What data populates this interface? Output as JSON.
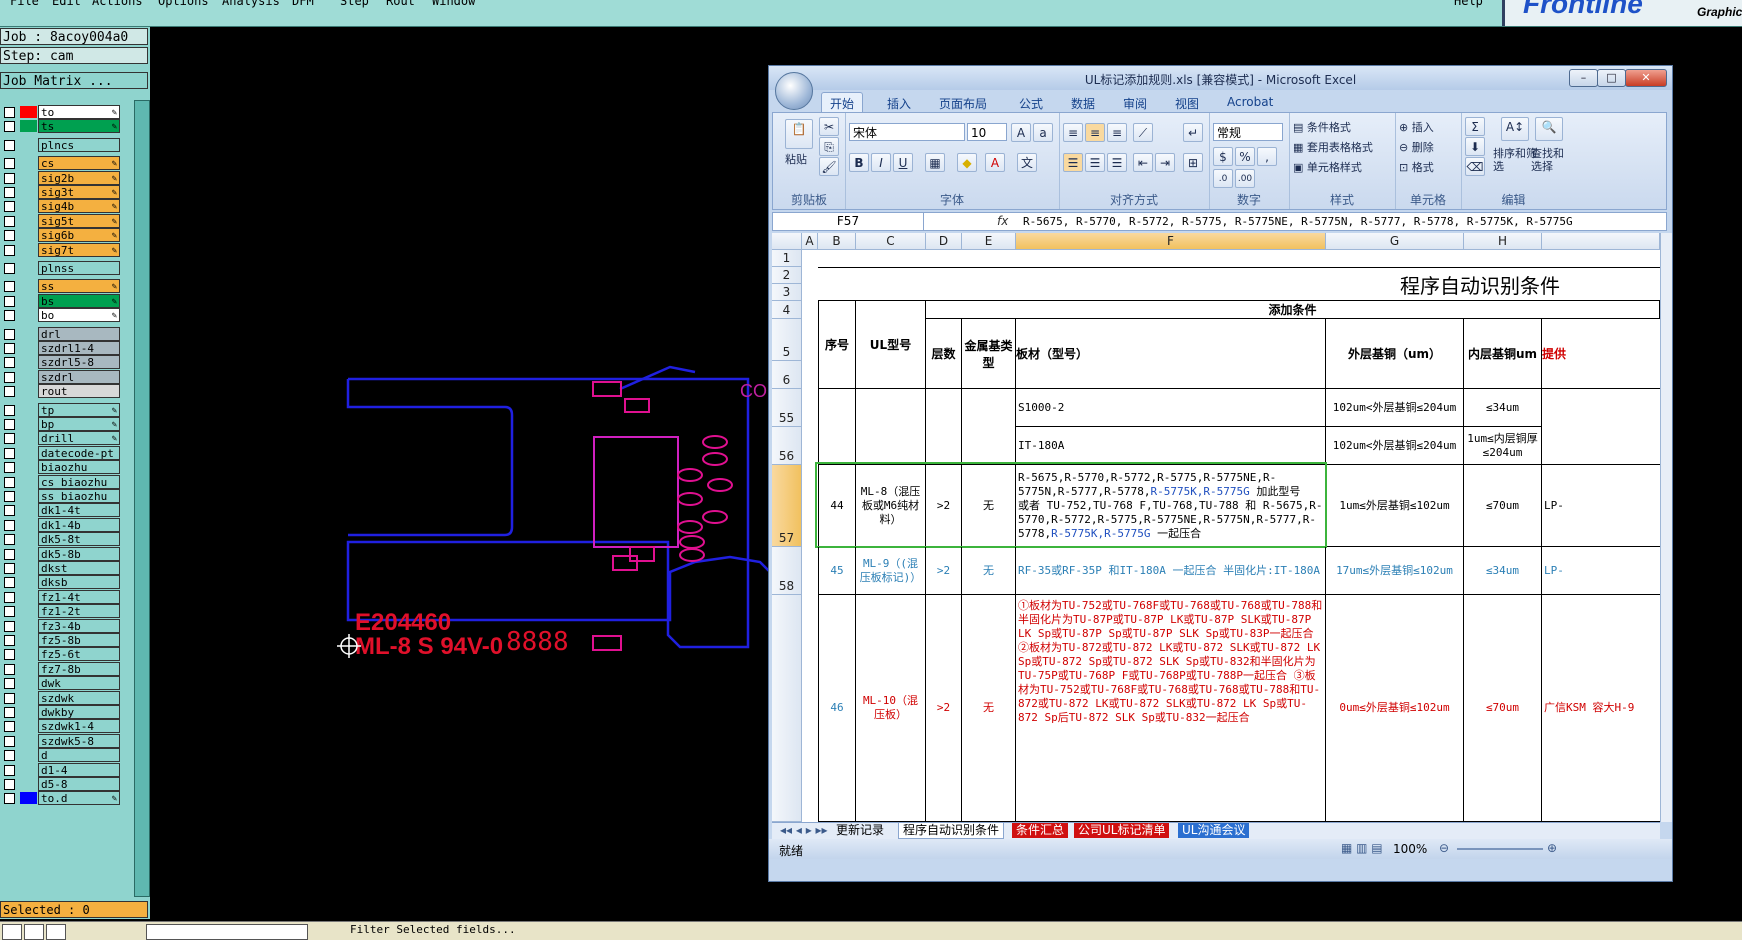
{
  "menubar": {
    "items": [
      "File",
      "Edit",
      "Actions",
      "Options",
      "Analysis",
      "DFM",
      "Step",
      "Rout",
      "Window"
    ],
    "help": "Help"
  },
  "logo": {
    "text": "Frontline",
    "sub": "Graphic"
  },
  "job": {
    "job_line": "Job : 8acoy004a0",
    "step_line": "Step: cam",
    "matrix_button": "Job Matrix ..."
  },
  "layers": [
    {
      "name": "to",
      "swatch": "#ff0000",
      "bg": "#ffffff",
      "pen": true
    },
    {
      "name": "ts",
      "swatch": "#00a050",
      "bg": "#00a050",
      "pen": true
    },
    {
      "name": "plncs",
      "swatch": "",
      "bg": "#8fd4ce",
      "pen": false
    },
    {
      "name": "cs",
      "swatch": "",
      "bg": "#f4b040",
      "pen": true
    },
    {
      "name": "sig2b",
      "swatch": "",
      "bg": "#f4b040",
      "pen": true
    },
    {
      "name": "sig3t",
      "swatch": "",
      "bg": "#f4b040",
      "pen": true
    },
    {
      "name": "sig4b",
      "swatch": "",
      "bg": "#f4b040",
      "pen": true
    },
    {
      "name": "sig5t",
      "swatch": "",
      "bg": "#f4b040",
      "pen": true
    },
    {
      "name": "sig6b",
      "swatch": "",
      "bg": "#f4b040",
      "pen": true
    },
    {
      "name": "sig7t",
      "swatch": "",
      "bg": "#f4b040",
      "pen": true
    },
    {
      "name": "plnss",
      "swatch": "",
      "bg": "#8fd4ce",
      "pen": false
    },
    {
      "name": "ss",
      "swatch": "",
      "bg": "#f4b040",
      "pen": true
    },
    {
      "name": "bs",
      "swatch": "",
      "bg": "#00a050",
      "pen": true
    },
    {
      "name": "bo",
      "swatch": "",
      "bg": "#ffffff",
      "pen": true
    },
    {
      "name": "drl",
      "swatch": "",
      "bg": "#a8b8c0",
      "pen": false
    },
    {
      "name": "szdrl1-4",
      "swatch": "",
      "bg": "#a8b8c0",
      "pen": false
    },
    {
      "name": "szdrl5-8",
      "swatch": "",
      "bg": "#a8b8c0",
      "pen": false
    },
    {
      "name": "szdrl",
      "swatch": "",
      "bg": "#a8b8c0",
      "pen": false
    },
    {
      "name": "rout",
      "swatch": "",
      "bg": "#d8d8d8",
      "pen": false
    },
    {
      "name": "tp",
      "swatch": "",
      "bg": "#8fd4ce",
      "pen": true
    },
    {
      "name": "bp",
      "swatch": "",
      "bg": "#8fd4ce",
      "pen": true
    },
    {
      "name": "drill",
      "swatch": "",
      "bg": "#8fd4ce",
      "pen": true
    },
    {
      "name": "datecode-pt",
      "swatch": "",
      "bg": "#8fd4ce",
      "pen": false
    },
    {
      "name": "biaozhu",
      "swatch": "",
      "bg": "#8fd4ce",
      "pen": false
    },
    {
      "name": "cs_biaozhu",
      "swatch": "",
      "bg": "#8fd4ce",
      "pen": false
    },
    {
      "name": "ss_biaozhu",
      "swatch": "",
      "bg": "#8fd4ce",
      "pen": false
    },
    {
      "name": "dk1-4t",
      "swatch": "",
      "bg": "#8fd4ce",
      "pen": false
    },
    {
      "name": "dk1-4b",
      "swatch": "",
      "bg": "#8fd4ce",
      "pen": false
    },
    {
      "name": "dk5-8t",
      "swatch": "",
      "bg": "#8fd4ce",
      "pen": false
    },
    {
      "name": "dk5-8b",
      "swatch": "",
      "bg": "#8fd4ce",
      "pen": false
    },
    {
      "name": "dkst",
      "swatch": "",
      "bg": "#8fd4ce",
      "pen": false
    },
    {
      "name": "dksb",
      "swatch": "",
      "bg": "#8fd4ce",
      "pen": false
    },
    {
      "name": "fz1-4t",
      "swatch": "",
      "bg": "#8fd4ce",
      "pen": false
    },
    {
      "name": "fz1-2t",
      "swatch": "",
      "bg": "#8fd4ce",
      "pen": false
    },
    {
      "name": "fz3-4b",
      "swatch": "",
      "bg": "#8fd4ce",
      "pen": false
    },
    {
      "name": "fz5-8b",
      "swatch": "",
      "bg": "#8fd4ce",
      "pen": false
    },
    {
      "name": "fz5-6t",
      "swatch": "",
      "bg": "#8fd4ce",
      "pen": false
    },
    {
      "name": "fz7-8b",
      "swatch": "",
      "bg": "#8fd4ce",
      "pen": false
    },
    {
      "name": "dwk",
      "swatch": "",
      "bg": "#8fd4ce",
      "pen": false
    },
    {
      "name": "szdwk",
      "swatch": "",
      "bg": "#8fd4ce",
      "pen": false
    },
    {
      "name": "dwkby",
      "swatch": "",
      "bg": "#8fd4ce",
      "pen": false
    },
    {
      "name": "szdwk1-4",
      "swatch": "",
      "bg": "#8fd4ce",
      "pen": false
    },
    {
      "name": "szdwk5-8",
      "swatch": "",
      "bg": "#8fd4ce",
      "pen": false
    },
    {
      "name": "d",
      "swatch": "",
      "bg": "#8fd4ce",
      "pen": false
    },
    {
      "name": "d1-4",
      "swatch": "",
      "bg": "#8fd4ce",
      "pen": false
    },
    {
      "name": "d5-8",
      "swatch": "",
      "bg": "#8fd4ce",
      "pen": false
    },
    {
      "name": "to.d",
      "swatch": "#0000ff",
      "bg": "#8fd4ce",
      "pen": true
    }
  ],
  "selected": "Selected : 0",
  "statusbar": {
    "text": "Filter Selected fields..."
  },
  "pcb": {
    "marking_line1": "E204460",
    "marking_line2": "ML-8 S 94V-0",
    "digits": "8888",
    "co_text": "CO"
  },
  "excel": {
    "title": "UL标记添加规则.xls [兼容模式] - Microsoft Excel",
    "tabs": [
      "开始",
      "插入",
      "页面布局",
      "公式",
      "数据",
      "审阅",
      "视图",
      "Acrobat"
    ],
    "ribbon": {
      "paste": "粘贴",
      "clipboard": "剪贴板",
      "font_name": "宋体",
      "font_size": "10",
      "font_group": "字体",
      "align_group": "对齐方式",
      "number_format": "常规",
      "number_group": "数字",
      "cond_format": "条件格式",
      "table_format": "套用表格格式",
      "cell_style": "单元格样式",
      "style_group": "样式",
      "insert": "插入",
      "delete": "删除",
      "format": "格式",
      "cells_group": "单元格",
      "sort": "排序和筛选",
      "find": "查找和选择",
      "edit_group": "编辑"
    },
    "name_box": "F57",
    "fx": "fx",
    "formula": "R-5675, R-5770, R-5772, R-5775, R-5775NE, R-5775N, R-5777, R-5778, R-5775K, R-5775G",
    "columns": [
      "A",
      "B",
      "C",
      "D",
      "E",
      "F",
      "G",
      "H"
    ],
    "rows": {
      "r1": "1",
      "r2": "2",
      "r3": "3",
      "r4": "4",
      "r5": "5",
      "r6": "6",
      "r55": "55",
      "r56": "56",
      "r57": "57",
      "r58": "58"
    },
    "sheet_title": "程序自动识别条件",
    "headers": {
      "add_cond": "添加条件",
      "no": "序号",
      "ul": "UL型号",
      "layers": "层数",
      "metal": "金属基类型",
      "material": "板材（型号）",
      "outer": "外层基铜（um）",
      "inner": "内层基铜um",
      "more": "提供"
    },
    "row55": {
      "f": "S1000-2",
      "g": "102um<外层基铜≤204um",
      "h": "≤34um"
    },
    "row56": {
      "f": "IT-180A",
      "g": "102um<外层基铜≤204um",
      "h": "1um≤内层铜厚≤204um"
    },
    "row57": {
      "b": "44",
      "c": "ML-8（混压板或M6纯材料）",
      "d": ">2",
      "e": "无",
      "f1": "R-5675,R-5770,R-5772,R-5775,R-5775NE,R-5775N,R-5777,R-5778,",
      "f1b": "R-5775K,R-5775G",
      "f1c": "加此型号",
      "f2": "或者 TU-752,TU-768 F,TU-768,TU-788 和 R-5675,R-5770,R-5772,R-5775,R-5775NE,R-5775N,R-5777,R-5778,",
      "f2b": "R-5775K,R-5775G",
      "f2c": "一起压合",
      "g": "1um≤外层基铜≤102um",
      "h": "≤70um",
      "i": "LP-"
    },
    "row58": {
      "b": "45",
      "c": "ML-9（(混压板标记)）",
      "d": ">2",
      "e": "无",
      "f": "RF-35或RF-35P 和IT-180A 一起压合  半固化片:IT-180A",
      "g": "17um≤外层基铜≤102um",
      "h": "≤34um",
      "i": "LP-"
    },
    "row59": {
      "b": "46",
      "c": "ML-10（混压板）",
      "d": ">2",
      "e": "无",
      "f": "①板材为TU-752或TU-768F或TU-768或TU-768或TU-788和半固化片为TU-87P或TU-87P LK或TU-87P SLK或TU-87P LK Sp或TU-87P Sp或TU-87P SLK Sp或TU-83P一起压合 ②板材为TU-872或TU-872 LK或TU-872 SLK或TU-872 LK Sp或TU-872 Sp或TU-872 SLK Sp或TU-832和半固化片为TU-75P或TU-768P F或TU-768P或TU-788P一起压合 ③板材为TU-752或TU-768F或TU-768或TU-768或TU-788和TU-872或TU-872 LK或TU-872 SLK或TU-872 LK Sp或TU-872 Sp后TU-872 SLK Sp或TU-832一起压合",
      "g": "0um≤外层基铜≤102um",
      "h": "≤70um",
      "i": "广信KSM 容大H-9"
    },
    "sheets": [
      "更新记录",
      "程序自动识别条件",
      "条件汇总",
      "公司UL标记清单",
      "UL沟通会议"
    ],
    "status": "就绪",
    "zoom": "100%"
  }
}
